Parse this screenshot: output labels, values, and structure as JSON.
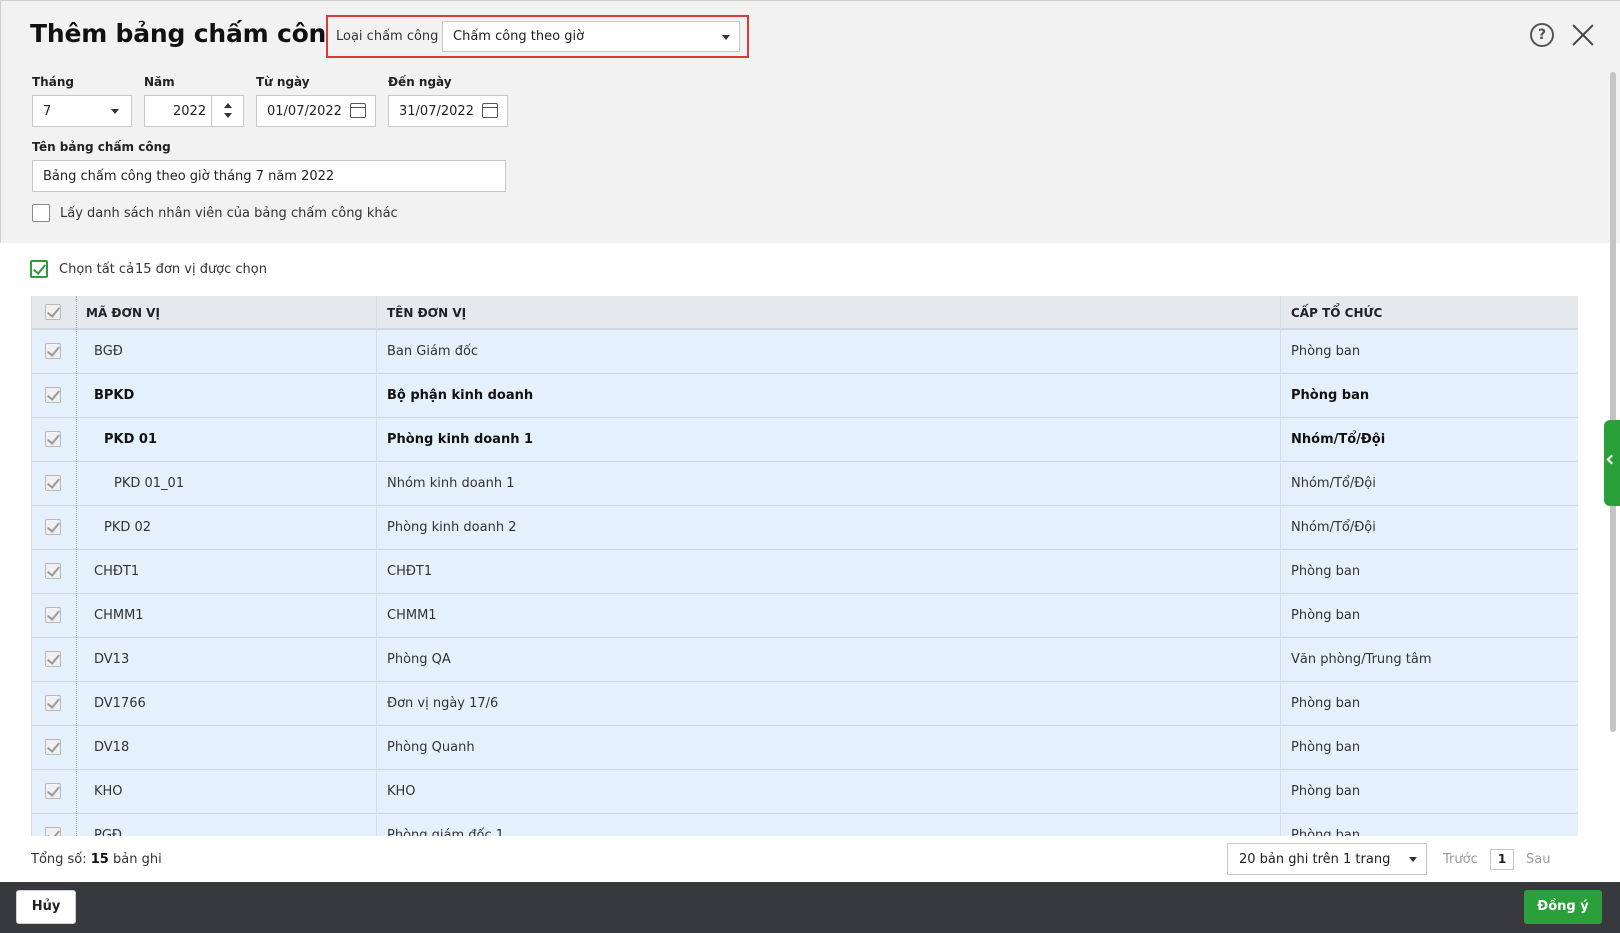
{
  "dialog": {
    "title": "Thêm bảng chấm công",
    "timesheet_type": {
      "label": "Loại chấm công",
      "value": "Chấm công theo giờ"
    }
  },
  "form": {
    "month": {
      "label": "Tháng",
      "value": "7"
    },
    "year": {
      "label": "Năm",
      "value": "2022"
    },
    "from_date": {
      "label": "Từ ngày",
      "value": "01/07/2022"
    },
    "to_date": {
      "label": "Đến ngày",
      "value": "31/07/2022"
    },
    "name": {
      "label": "Tên bảng chấm công",
      "value": "Bảng chấm công theo giờ tháng 7 năm 2022"
    },
    "copy_employees_label": "Lấy danh sách nhân viên của bảng chấm công khác"
  },
  "selection": {
    "select_all_label": "Chọn tất cả",
    "selected_count_text": "15 đơn vị được chọn"
  },
  "table": {
    "columns": [
      "MÃ ĐƠN VỊ",
      "TÊN ĐƠN VỊ",
      "CẤP TỔ CHỨC"
    ],
    "rows": [
      {
        "code": "BGĐ",
        "name": "Ban Giám đốc",
        "level": "Phòng ban",
        "indent": 0,
        "bold": false
      },
      {
        "code": "BPKD",
        "name": "Bộ phận kinh doanh",
        "level": "Phòng ban",
        "indent": 0,
        "bold": true
      },
      {
        "code": "PKD 01",
        "name": "Phòng kinh doanh 1",
        "level": "Nhóm/Tổ/Đội",
        "indent": 1,
        "bold": true
      },
      {
        "code": "PKD 01_01",
        "name": "Nhóm kinh doanh 1",
        "level": "Nhóm/Tổ/Đội",
        "indent": 2,
        "bold": false
      },
      {
        "code": "PKD 02",
        "name": "Phòng kinh doanh 2",
        "level": "Nhóm/Tổ/Đội",
        "indent": 1,
        "bold": false
      },
      {
        "code": "CHĐT1",
        "name": "CHĐT1",
        "level": "Phòng ban",
        "indent": 0,
        "bold": false
      },
      {
        "code": "CHMM1",
        "name": "CHMM1",
        "level": "Phòng ban",
        "indent": 0,
        "bold": false
      },
      {
        "code": "DV13",
        "name": "Phòng QA",
        "level": "Văn phòng/Trung tâm",
        "indent": 0,
        "bold": false
      },
      {
        "code": "DV1766",
        "name": "Đơn vị ngày 17/6",
        "level": "Phòng ban",
        "indent": 0,
        "bold": false
      },
      {
        "code": "DV18",
        "name": "Phòng Quanh",
        "level": "Phòng ban",
        "indent": 0,
        "bold": false
      },
      {
        "code": "KHO",
        "name": "KHO",
        "level": "Phòng ban",
        "indent": 0,
        "bold": false
      },
      {
        "code": "PGĐ",
        "name": "Phòng giám đốc 1",
        "level": "Phòng ban",
        "indent": 0,
        "bold": false
      }
    ]
  },
  "footer": {
    "total_prefix": "Tổng số:",
    "total_count": "15",
    "total_suffix": "bản ghi",
    "page_size": "20 bản ghi trên 1 trang",
    "prev": "Trước",
    "page": "1",
    "next": "Sau"
  },
  "actions": {
    "cancel": "Hủy",
    "ok": "Đồng ý"
  }
}
